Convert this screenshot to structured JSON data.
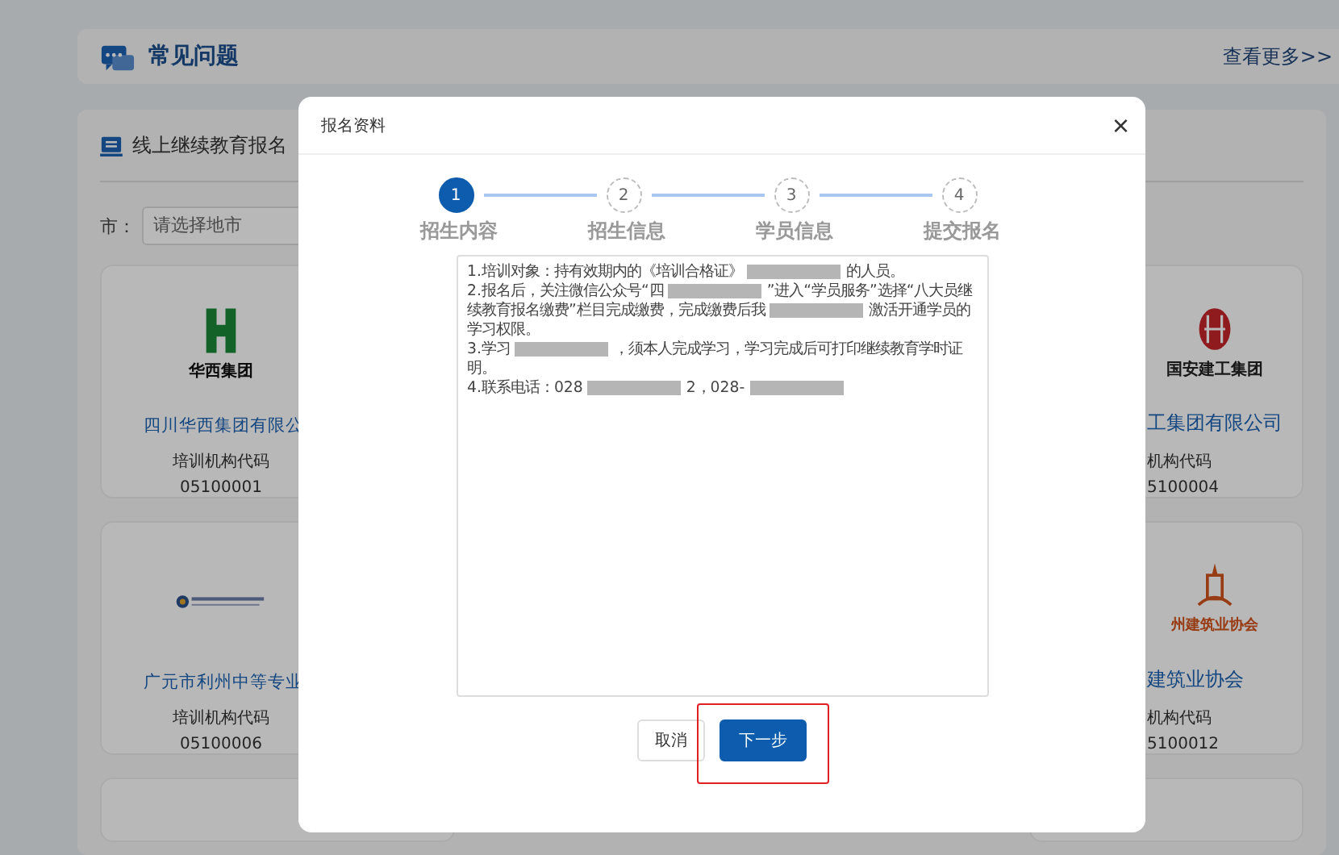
{
  "faq": {
    "title": "常见问题",
    "more_link": "查看更多>>"
  },
  "enroll": {
    "title": "线上继续教育报名",
    "city_filter": {
      "label": "市：",
      "placeholder": "请选择地市"
    },
    "card_rows": [
      {
        "cards": [
          {
            "kind": "green",
            "logo_text": "华西集团",
            "name": "四川华西集团有限公",
            "code_label": "培训机构代码",
            "code": "05100001"
          },
          {
            "kind": "red-seal",
            "logo_text": "国安建工集团",
            "name": "工集团有限公司",
            "code_label": "机构代码",
            "code": "5100004"
          }
        ]
      },
      {
        "cards": [
          {
            "kind": "school",
            "name": "广元市利州中等专业",
            "code_label": "培训机构代码",
            "code": "05100006"
          },
          {
            "kind": "orange-tower",
            "logo_text": "州建筑业协会",
            "name": "建筑业协会",
            "code_label": "机构代码",
            "code": "5100012"
          }
        ]
      }
    ]
  },
  "modal": {
    "title": "报名资料",
    "close": "×",
    "steps": [
      {
        "number": "1",
        "label": "招生内容",
        "selected": true
      },
      {
        "number": "2",
        "label": "招生信息",
        "selected": false
      },
      {
        "number": "3",
        "label": "学员信息",
        "selected": false
      },
      {
        "number": "4",
        "label": "提交报名",
        "selected": false
      }
    ],
    "content": [
      [
        {
          "kind": "text",
          "text": "1.培训对象：持有效期内的《培训合格证》"
        },
        {
          "kind": "redaction"
        },
        {
          "kind": "text",
          "text": "的人员。"
        }
      ],
      [
        {
          "kind": "text",
          "text": "2.报名后，关注微信公众号“四"
        },
        {
          "kind": "redaction"
        },
        {
          "kind": "text",
          "text": "”进入“学员服务”选择“八大员继续教育报名缴费”栏目完成缴费，完成缴费后我"
        },
        {
          "kind": "redaction"
        },
        {
          "kind": "text",
          "text": "激活开通学员的学习权限。"
        }
      ],
      [
        {
          "kind": "text",
          "text": "3.学习"
        },
        {
          "kind": "redaction"
        },
        {
          "kind": "text",
          "text": "，须本人完成学习，学习完成后可打印继续教育学时证明。"
        }
      ],
      [
        {
          "kind": "text",
          "text": "4.联系电话：028"
        },
        {
          "kind": "redaction"
        },
        {
          "kind": "text",
          "text": "2，028-"
        },
        {
          "kind": "redaction"
        }
      ]
    ],
    "buttons": [
      {
        "label": "取消",
        "kind": "secondary",
        "highlighted": false
      },
      {
        "label": "下一步",
        "kind": "primary",
        "highlighted": true
      }
    ]
  }
}
